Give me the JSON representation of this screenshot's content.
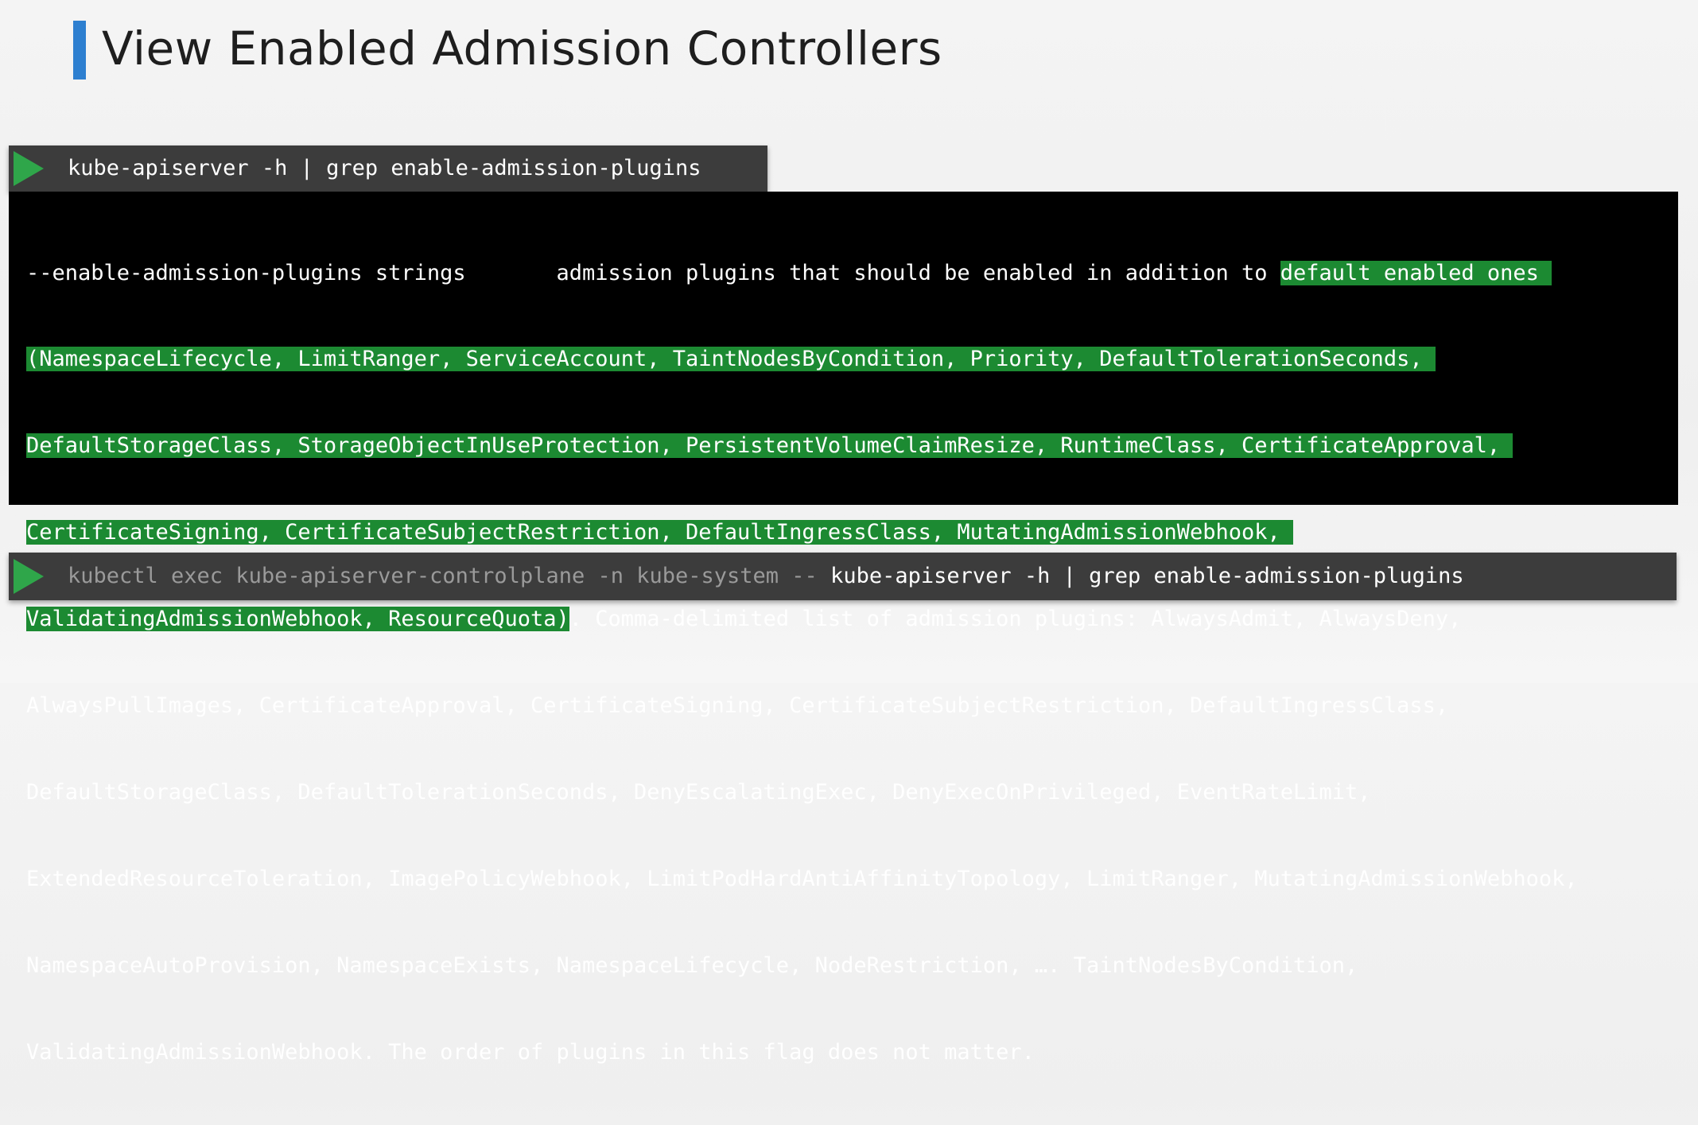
{
  "slide": {
    "title": "View Enabled Admission Controllers",
    "accent_color": "#2d7fd0",
    "highlight_color": "#1c8a32",
    "play_icon_color": "#2fa64a"
  },
  "command1": {
    "icon": "play-icon",
    "text": "kube-apiserver -h | grep enable-admission-plugins"
  },
  "output": {
    "line1_plain": "--enable-admission-plugins strings       admission plugins that should be enabled in addition to ",
    "line1_hl": "default enabled ones ",
    "line2_hl": "(NamespaceLifecycle, LimitRanger, ServiceAccount, TaintNodesByCondition, Priority, DefaultTolerationSeconds, ",
    "line3_hl": "DefaultStorageClass, StorageObjectInUseProtection, PersistentVolumeClaimResize, RuntimeClass, CertificateApproval, ",
    "line4_hl": "CertificateSigning, CertificateSubjectRestriction, DefaultIngressClass, MutatingAdmissionWebhook, ",
    "line5_hl": "ValidatingAdmissionWebhook, ResourceQuota)",
    "line5_plain": ". Comma-delimited list of admission plugins: AlwaysAdmit, AlwaysDeny,",
    "line6": "AlwaysPullImages, CertificateApproval, CertificateSigning, CertificateSubjectRestriction, DefaultIngressClass,",
    "line7": "DefaultStorageClass, DefaultTolerationSeconds, DenyEscalatingExec, DenyExecOnPrivileged, EventRateLimit,",
    "line8": "ExtendedResourceToleration, ImagePolicyWebhook, LimitPodHardAntiAffinityTopology, LimitRanger, MutatingAdmissionWebhook,",
    "line9": "NamespaceAutoProvision, NamespaceExists, NamespaceLifecycle, NodeRestriction, …. TaintNodesByCondition,",
    "line10": "ValidatingAdmissionWebhook. The order of plugins in this flag does not matter."
  },
  "command2": {
    "icon": "play-icon",
    "text_dim": "kubectl exec kube-apiserver-controlplane -n kube-system -- ",
    "text_bright": "kube-apiserver -h | grep enable-admission-plugins"
  }
}
